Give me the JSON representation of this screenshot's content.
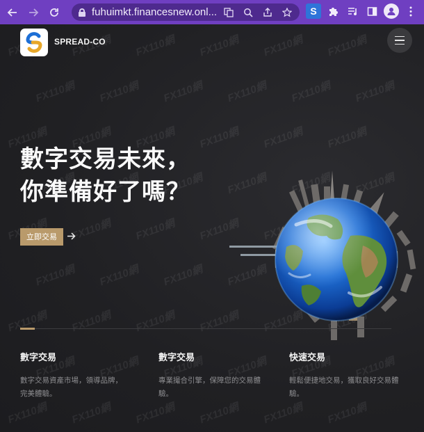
{
  "browser": {
    "url": "fuhuimkt.financesnew.onl...",
    "back_icon": "arrow-left-icon",
    "forward_icon": "arrow-right-icon",
    "reload_icon": "reload-icon"
  },
  "header": {
    "brand": "SPREAD-CO"
  },
  "hero": {
    "line1": "數字交易未來，",
    "line2": "你準備好了嗎？",
    "cta_label": "立即交易"
  },
  "features": [
    {
      "title": "數字交易",
      "desc": "數字交易資產市場，領導品牌，完美體驗。"
    },
    {
      "title": "數字交易",
      "desc": "專業撮合引擎，保障您的交易體驗。"
    },
    {
      "title": "快速交易",
      "desc": "輕鬆便捷地交易，獲取良好交易體驗。"
    }
  ],
  "watermark": "FX110網",
  "colors": {
    "browser_accent": "#6f3fc1",
    "brand_gold": "#b99a6b",
    "background": "#232326"
  }
}
